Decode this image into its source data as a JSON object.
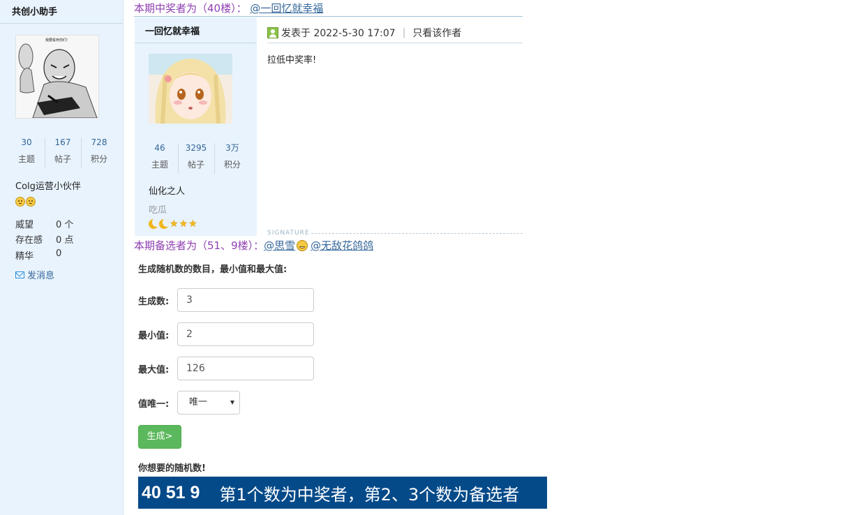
{
  "sidebar": {
    "username": "共创小助手",
    "avatar_caption": "我要看死你们!",
    "stats": [
      {
        "value": "30",
        "label": "主题"
      },
      {
        "value": "167",
        "label": "帖子"
      },
      {
        "value": "728",
        "label": "积分"
      }
    ],
    "title": "Colg运营小伙伴",
    "attributes": [
      {
        "label": "威望",
        "value": "0 个"
      },
      {
        "label": "存在感",
        "value": "0 点"
      },
      {
        "label": "精华",
        "value": "0"
      }
    ],
    "send_message": "发消息"
  },
  "winner": {
    "text": "本期中奖者为（40楼）：",
    "user": "@一回忆就幸福"
  },
  "post": {
    "author": "一回忆就幸福",
    "stats": [
      {
        "value": "46",
        "label": "主题"
      },
      {
        "value": "3295",
        "label": "帖子"
      },
      {
        "value": "3万",
        "label": "积分"
      }
    ],
    "title": "仙化之人",
    "group": "吃瓜",
    "posted_at": "发表于 2022-5-30 17:07",
    "only_author": "只看该作者",
    "content": "拉低中奖率!",
    "signature_label": "SIGNATURE"
  },
  "backup": {
    "text": "本期备选者为（51、9楼）：",
    "user1": "@思雪",
    "user2": "@无敌花鸽鸽"
  },
  "form": {
    "intro": "生成随机数的数目，最小值和最大值:",
    "count_label": "生成数:",
    "count_value": "3",
    "min_label": "最小值:",
    "min_value": "2",
    "max_label": "最大值:",
    "max_value": "126",
    "unique_label": "值唯一:",
    "unique_value": "唯一",
    "generate_button": "生成>",
    "result_title": "你想要的随机数!",
    "result_numbers": "40 51 9",
    "result_note": "第1个数为中奖者，第2、3个数为备选者"
  },
  "colors": {
    "heading": "#8f3fb2",
    "link": "#336699",
    "sidebar_bg": "#e8f3fd",
    "button_green": "#5cb85c",
    "result_bg": "#044a89"
  }
}
